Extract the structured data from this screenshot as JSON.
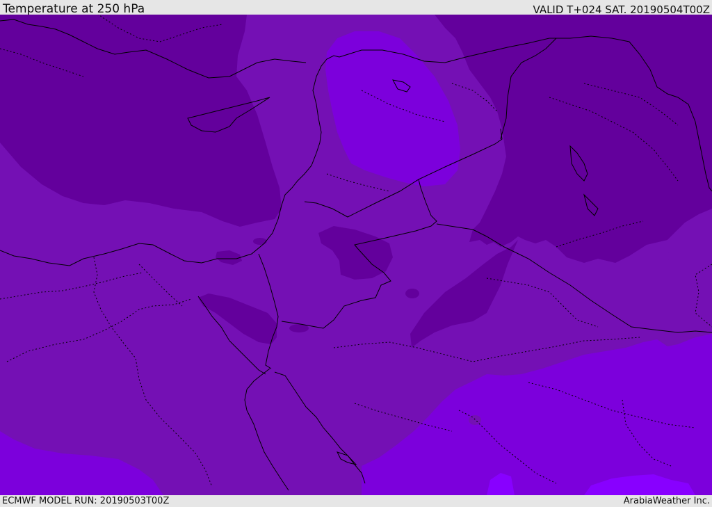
{
  "header": {
    "title": "Temperature at 250 hPa",
    "valid_time": "VALID T+024 SAT. 20190504T00Z"
  },
  "footer": {
    "model_run": "ECMWF MODEL RUN: 20190503T00Z",
    "credit": "ArabiaWeather Inc."
  },
  "map": {
    "fill_colors": {
      "coldest": "#63009c",
      "cold": "#7410b4",
      "mild": "#7c00dc",
      "warm": "#8800ff"
    },
    "boundary_color": "#000000"
  }
}
